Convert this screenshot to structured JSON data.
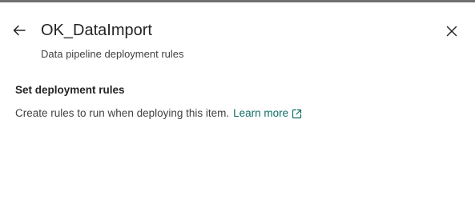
{
  "panel": {
    "title": "OK_DataImport",
    "subtitle": "Data pipeline deployment rules",
    "back_icon": "arrow-left-icon",
    "close_icon": "close-icon"
  },
  "section": {
    "heading": "Set deployment rules",
    "description": "Create rules to run when deploying this item.",
    "link_label": "Learn more",
    "link_icon": "open-external-icon"
  },
  "colors": {
    "link": "#0f6f63",
    "text": "#242424",
    "secondary_text": "#424242",
    "top_border": "#707070"
  }
}
